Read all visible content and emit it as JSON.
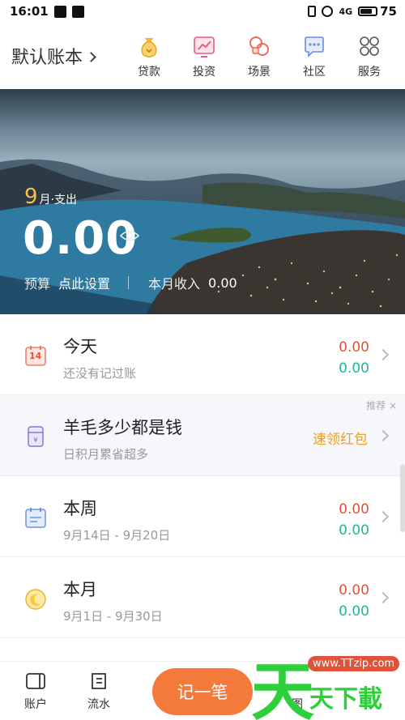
{
  "status_bar": {
    "time": "16:01",
    "battery": "75"
  },
  "header": {
    "book_title": "默认账本"
  },
  "nav": [
    {
      "label": "贷款",
      "icon": "money-bag-icon"
    },
    {
      "label": "投资",
      "icon": "trend-chart-icon"
    },
    {
      "label": "场景",
      "icon": "scene-icon"
    },
    {
      "label": "社区",
      "icon": "chat-bubble-icon"
    },
    {
      "label": "服务",
      "icon": "grid-services-icon"
    }
  ],
  "banner": {
    "month": "9",
    "month_suffix": "月·支出",
    "amount": "0.00",
    "budget_label": "预算",
    "budget_action": "点此设置",
    "income_label": "本月收入",
    "income_value": "0.00"
  },
  "rows": {
    "today": {
      "title": "今天",
      "sub": "还没有记过账",
      "expense": "0.00",
      "income": "0.00",
      "icon_num": "14"
    },
    "promo": {
      "tag": "推荐 ×",
      "title": "羊毛多少都是钱",
      "sub": "日积月累省超多",
      "action": "速领红包"
    },
    "week": {
      "title": "本周",
      "sub": "9月14日 - 9月20日",
      "expense": "0.00",
      "income": "0.00"
    },
    "month": {
      "title": "本月",
      "sub": "9月1日 - 9月30日",
      "expense": "0.00",
      "income": "0.00"
    }
  },
  "bottom": {
    "account": "账户",
    "flow": "流水",
    "record": "记一笔",
    "chart_partial": "图"
  },
  "watermark": {
    "big": "天",
    "small": "天下載",
    "url": "www.TTzip.com"
  },
  "colors": {
    "accent_orange": "#f37a3b",
    "expense_red": "#e0533b",
    "income_green": "#25b49a",
    "month_yellow": "#f6c04a"
  }
}
